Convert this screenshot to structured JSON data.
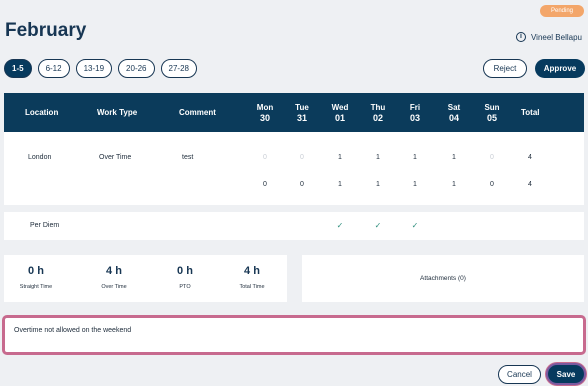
{
  "status": "Pending",
  "title": "February",
  "user": {
    "name": "Vineel Bellapu",
    "icon": "info-icon"
  },
  "ranges": [
    "1-5",
    "6-12",
    "13-19",
    "20-26",
    "27-28"
  ],
  "active_range": "1-5",
  "actions": {
    "reject": "Reject",
    "approve": "Approve"
  },
  "table": {
    "headers": {
      "location": "Location",
      "work_type": "Work Type",
      "comment": "Comment",
      "total": "Total"
    },
    "days": [
      {
        "dow": "Mon",
        "date": "30"
      },
      {
        "dow": "Tue",
        "date": "31"
      },
      {
        "dow": "Wed",
        "date": "01"
      },
      {
        "dow": "Thu",
        "date": "02"
      },
      {
        "dow": "Fri",
        "date": "03"
      },
      {
        "dow": "Sat",
        "date": "04"
      },
      {
        "dow": "Sun",
        "date": "05"
      }
    ],
    "row": {
      "location": "London",
      "work_type": "Over Time",
      "comment": "test",
      "values": [
        "0",
        "0",
        "1",
        "1",
        "1",
        "1",
        "0"
      ],
      "total": "4"
    },
    "totals_row": {
      "values": [
        "0",
        "0",
        "1",
        "1",
        "1",
        "1",
        "0"
      ],
      "total": "4"
    }
  },
  "per_diem": {
    "label": "Per Diem",
    "checks": [
      "",
      "",
      "✓",
      "✓",
      "✓",
      "",
      ""
    ]
  },
  "summary": [
    {
      "value": "0 h",
      "label": "Straight Time"
    },
    {
      "value": "4 h",
      "label": "Over Time"
    },
    {
      "value": "0 h",
      "label": "PTO"
    },
    {
      "value": "4 h",
      "label": "Total Time"
    }
  ],
  "attachments": "Attachments (0)",
  "comment_text": "Overtime not allowed on the weekend",
  "footer": {
    "cancel": "Cancel",
    "save": "Save"
  },
  "colors": {
    "primary": "#063a5e",
    "header": "#0b3b5b",
    "pending": "#f3a66a",
    "focus": "#c76a8e"
  }
}
